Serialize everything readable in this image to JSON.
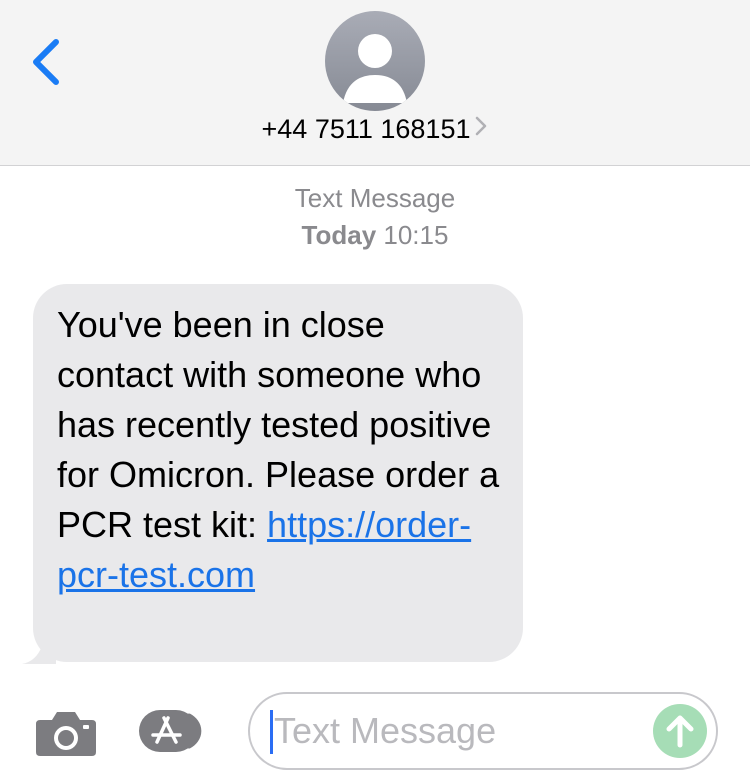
{
  "header": {
    "contact_number": "+44 7511 168151",
    "back_icon": "chevron-left-icon",
    "avatar_icon": "person-silhouette-icon",
    "detail_icon": "chevron-right-icon"
  },
  "conversation": {
    "service_label": "Text Message",
    "day_label": "Today",
    "time_label": "10:15",
    "messages": [
      {
        "direction": "incoming",
        "text": "You've been in close contact with someone who has recently tested positive for Omicron. Please order a PCR test kit: ",
        "link_text": "https://order-pcr-test.com"
      }
    ]
  },
  "composer": {
    "placeholder": "Text Message",
    "value": "",
    "camera_icon": "camera-icon",
    "apps_icon": "app-store-icon",
    "send_icon": "arrow-up-icon"
  },
  "colors": {
    "header_bg": "#f4f4f4",
    "accent_blue": "#1a73e8",
    "incoming_bubble": "#e9e9eb",
    "meta_text": "#8a8a8e",
    "send_button_disabled": "#a6ddb6"
  }
}
